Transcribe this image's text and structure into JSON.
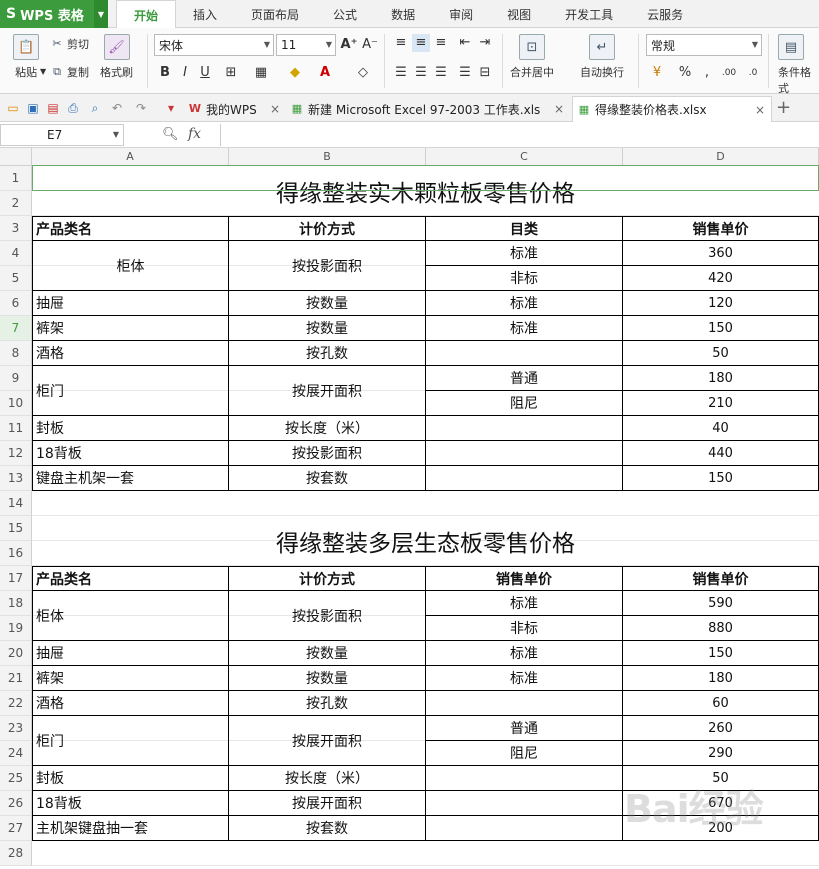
{
  "app": {
    "name": "WPS 表格",
    "logo_letter": "S",
    "tabs": [
      "开始",
      "插入",
      "页面布局",
      "公式",
      "数据",
      "审阅",
      "视图",
      "开发工具",
      "云服务"
    ],
    "active_tab": "开始"
  },
  "ribbon": {
    "paste": "粘贴",
    "cut": "剪切",
    "copy": "复制",
    "format_painter": "格式刷",
    "font_name": "宋体",
    "font_size": "11",
    "merge_center": "合并居中",
    "wrap_text": "自动换行",
    "number_format": "常规",
    "conditional_format": "条件格式"
  },
  "doc_tabs": [
    {
      "label": "我的WPS",
      "icon": "wps-home-icon"
    },
    {
      "label": "新建 Microsoft Excel 97-2003 工作表.xls",
      "icon": "spreadsheet-icon"
    },
    {
      "label": "得缘整装价格表.xlsx",
      "icon": "spreadsheet-icon",
      "active": true
    }
  ],
  "formula_bar": {
    "name_box": "E7",
    "fx": "fx",
    "content": ""
  },
  "grid": {
    "columns": [
      "A",
      "B",
      "C",
      "D"
    ],
    "selected_row": 7,
    "rows": [
      "1",
      "2",
      "3",
      "4",
      "5",
      "6",
      "7",
      "8",
      "9",
      "10",
      "11",
      "12",
      "13",
      "14",
      "15",
      "16",
      "17",
      "18",
      "19",
      "20",
      "21",
      "22",
      "23",
      "24",
      "25",
      "26",
      "27",
      "28"
    ]
  },
  "sheet": {
    "table1": {
      "title": "得缘整装实木颗粒板零售价格",
      "headers": [
        "产品类名",
        "计价方式",
        "目类",
        "销售单价"
      ],
      "items": [
        {
          "name": "柜体",
          "method": "按投影面积",
          "sub": [
            "标准",
            "非标"
          ],
          "prices": [
            "360",
            "420"
          ]
        },
        {
          "name": "抽屉",
          "method": "按数量",
          "sub": [
            "标准"
          ],
          "prices": [
            "120"
          ]
        },
        {
          "name": "裤架",
          "method": "按数量",
          "sub": [
            "标准"
          ],
          "prices": [
            "150"
          ]
        },
        {
          "name": "酒格",
          "method": "按孔数",
          "sub": [
            ""
          ],
          "prices": [
            "50"
          ]
        },
        {
          "name": "柜门",
          "method": "按展开面积",
          "sub": [
            "普通",
            "阻尼"
          ],
          "prices": [
            "180",
            "210"
          ]
        },
        {
          "name": "封板",
          "method": "按长度（米）",
          "sub": [
            ""
          ],
          "prices": [
            "40"
          ]
        },
        {
          "name": "18背板",
          "method": "按投影面积",
          "sub": [
            ""
          ],
          "prices": [
            "440"
          ]
        },
        {
          "name": "键盘主机架一套",
          "method": "按套数",
          "sub": [
            ""
          ],
          "prices": [
            "150"
          ]
        }
      ]
    },
    "table2": {
      "title": "得缘整装多层生态板零售价格",
      "headers": [
        "产品类名",
        "计价方式",
        "销售单价",
        "销售单价"
      ],
      "items": [
        {
          "name": "柜体",
          "method": "按投影面积",
          "sub": [
            "标准",
            "非标"
          ],
          "prices": [
            "590",
            "880"
          ]
        },
        {
          "name": "抽屉",
          "method": "按数量",
          "sub": [
            "标准"
          ],
          "prices": [
            "150"
          ]
        },
        {
          "name": "裤架",
          "method": "按数量",
          "sub": [
            "标准"
          ],
          "prices": [
            "180"
          ]
        },
        {
          "name": "酒格",
          "method": "按孔数",
          "sub": [
            ""
          ],
          "prices": [
            "60"
          ]
        },
        {
          "name": "柜门",
          "method": "按展开面积",
          "sub": [
            "普通",
            "阻尼"
          ],
          "prices": [
            "260",
            "290"
          ]
        },
        {
          "name": "封板",
          "method": "按长度（米）",
          "sub": [
            ""
          ],
          "prices": [
            "50"
          ]
        },
        {
          "name": "18背板",
          "method": "按展开面积",
          "sub": [
            ""
          ],
          "prices": [
            "670"
          ]
        },
        {
          "name": "主机架键盘抽一套",
          "method": "按套数",
          "sub": [
            ""
          ],
          "prices": [
            "200"
          ]
        }
      ]
    }
  },
  "watermark": "Bai经验"
}
